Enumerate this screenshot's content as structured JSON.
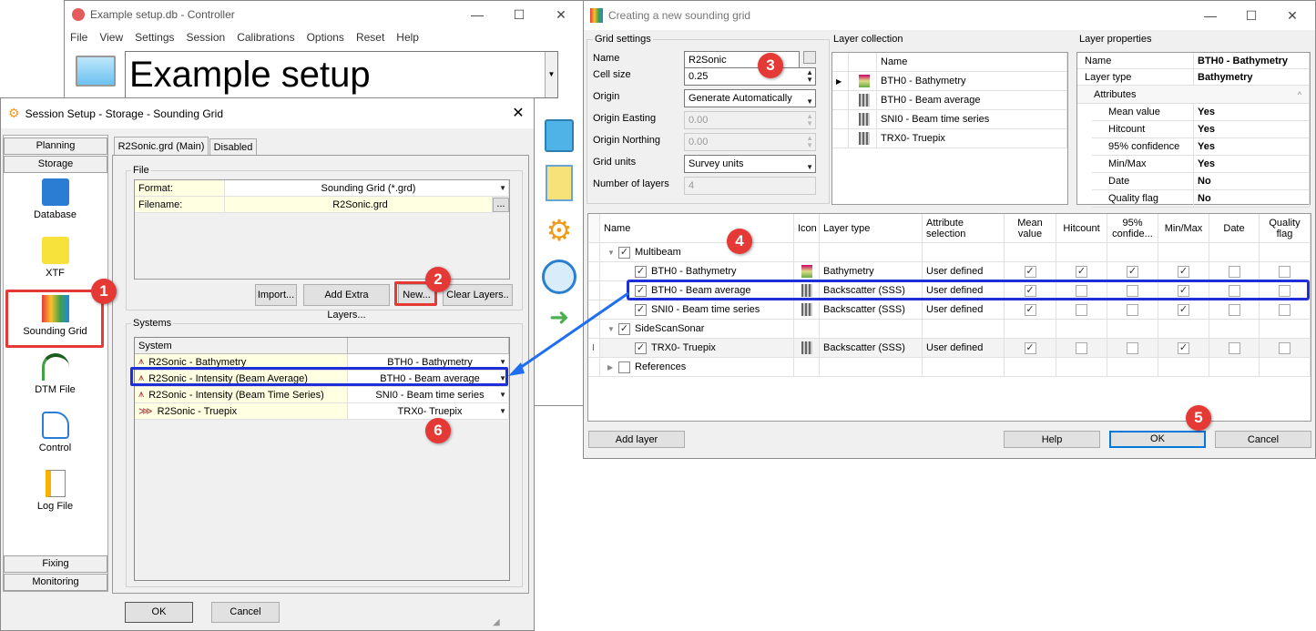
{
  "controller": {
    "title": "Example setup.db - Controller",
    "menu": [
      "File",
      "View",
      "Settings",
      "Session",
      "Calibrations",
      "Options",
      "Reset",
      "Help"
    ],
    "setup_name": "Example setup"
  },
  "session": {
    "title": "Session Setup - Storage -  Sounding Grid",
    "nav_top": [
      "Planning",
      "Storage"
    ],
    "nav_items": [
      "Database",
      "XTF",
      "Sounding Grid",
      "DTM File",
      "Control",
      "Log File"
    ],
    "nav_bottom": [
      "Fixing",
      "Monitoring"
    ],
    "tabs": [
      "R2Sonic.grd (Main)",
      "Disabled"
    ],
    "file_group": "File",
    "format_label": "Format:",
    "format_value": "Sounding Grid (*.grd)",
    "filename_label": "Filename:",
    "filename_value": "R2Sonic.grd",
    "browse": "...",
    "buttons": [
      "Import...",
      "Add Extra Layers...",
      "New...",
      "Clear Layers.."
    ],
    "systems_group": "Systems",
    "systems_header": "System",
    "systems": [
      {
        "name": "R2Sonic - Bathymetry",
        "layer": "BTH0 - Bathymetry"
      },
      {
        "name": "R2Sonic - Intensity (Beam Average)",
        "layer": "BTH0 - Beam average"
      },
      {
        "name": "R2Sonic - Intensity (Beam Time Series)",
        "layer": "SNI0 - Beam time series"
      },
      {
        "name": "R2Sonic - Truepix",
        "layer": "TRX0- Truepix"
      }
    ],
    "ok": "OK",
    "cancel": "Cancel"
  },
  "grid_dialog": {
    "title": "Creating a new sounding grid",
    "grid_settings": "Grid settings",
    "fields": [
      {
        "label": "Name",
        "value": "R2Sonic"
      },
      {
        "label": "Cell size",
        "value": "0.25"
      },
      {
        "label": "Origin",
        "value": "Generate Automatically"
      },
      {
        "label": "Origin Easting",
        "value": "0.00"
      },
      {
        "label": "Origin Northing",
        "value": "0.00"
      },
      {
        "label": "Grid units",
        "value": "Survey units"
      },
      {
        "label": "Number of layers",
        "value": "4"
      }
    ],
    "layer_collection": "Layer collection",
    "collection_header": "Name",
    "collection": [
      "BTH0 - Bathymetry",
      "BTH0 - Beam average",
      "SNI0 - Beam time series",
      "TRX0- Truepix"
    ],
    "layer_properties": "Layer properties",
    "properties": [
      {
        "k": "Name",
        "v": "BTH0 - Bathymetry"
      },
      {
        "k": "Layer type",
        "v": "Bathymetry"
      }
    ],
    "attributes_label": "Attributes",
    "attributes": [
      {
        "k": "Mean value",
        "v": "Yes"
      },
      {
        "k": "Hitcount",
        "v": "Yes"
      },
      {
        "k": "95% confidence",
        "v": "Yes"
      },
      {
        "k": "Min/Max",
        "v": "Yes"
      },
      {
        "k": "Date",
        "v": "No"
      },
      {
        "k": "Quality flag",
        "v": "No"
      }
    ],
    "columns": [
      "Name",
      "Icon",
      "Layer type",
      "Attribute selection",
      "Mean value",
      "Hitcount",
      "95% confide...",
      "Min/Max",
      "Date",
      "Quality flag"
    ],
    "rows": [
      {
        "name": "Multibeam",
        "group": true,
        "checked": true,
        "expanded": true
      },
      {
        "name": "BTH0 - Bathymetry",
        "checked": true,
        "icon": "bathymetry-icon",
        "type": "Bathymetry",
        "attr": "User defined",
        "flags": [
          true,
          true,
          true,
          true,
          false,
          false
        ]
      },
      {
        "name": "BTH0 - Beam average",
        "checked": true,
        "icon": "backscatter-icon",
        "type": "Backscatter (SSS)",
        "attr": "User defined",
        "flags": [
          true,
          false,
          false,
          true,
          false,
          false
        ]
      },
      {
        "name": "SNI0 - Beam time series",
        "checked": true,
        "icon": "backscatter-icon",
        "type": "Backscatter (SSS)",
        "attr": "User defined",
        "flags": [
          true,
          false,
          false,
          true,
          false,
          false
        ]
      },
      {
        "name": "SideScanSonar",
        "group": true,
        "checked": true,
        "expanded": true
      },
      {
        "name": "TRX0- Truepix",
        "checked": true,
        "icon": "backscatter-icon",
        "type": "Backscatter (SSS)",
        "attr": "User defined",
        "flags": [
          true,
          false,
          false,
          true,
          false,
          false
        ]
      },
      {
        "name": "References",
        "group": true,
        "checked": false,
        "expanded": false
      }
    ],
    "add_layer": "Add layer",
    "help": "Help",
    "ok": "OK",
    "cancel": "Cancel"
  },
  "annotations": [
    "1",
    "2",
    "3",
    "4",
    "5",
    "6"
  ],
  "colors": {
    "annotation_red": "#e53935",
    "highlight_blue": "#1f2fd8",
    "field_yellow": "#ffffe1"
  }
}
